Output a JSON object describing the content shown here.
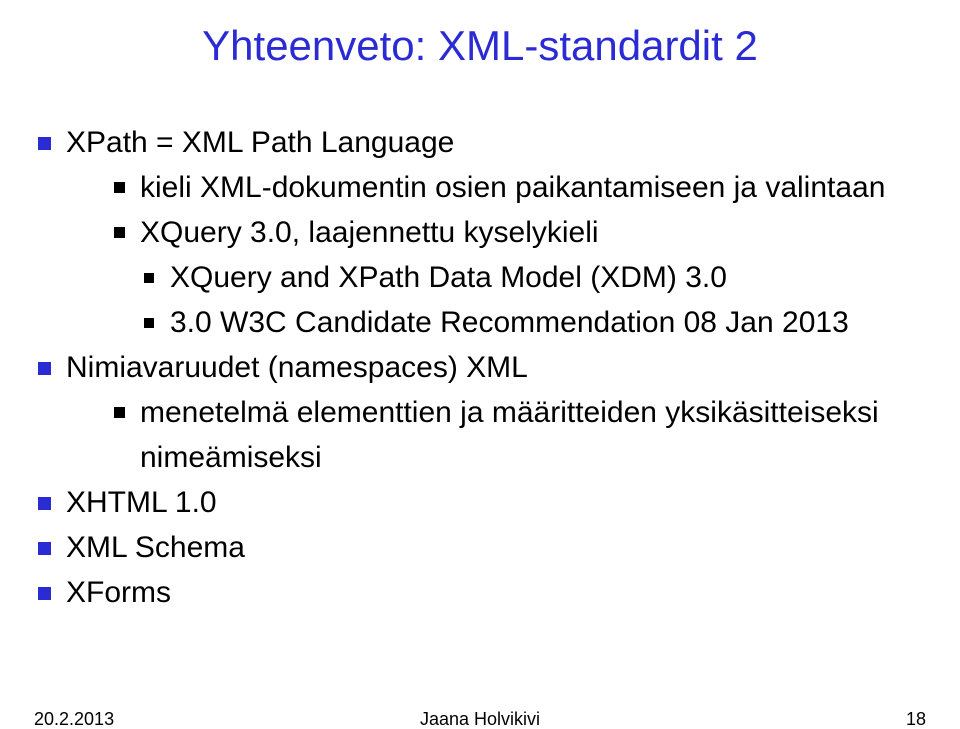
{
  "title": "Yhteenveto: XML-standardit 2",
  "bullets": {
    "b1": "XPath = XML Path Language",
    "b1_1": "kieli XML-dokumentin osien paikantamiseen ja valintaan",
    "b1_2": "XQuery 3.0, laajennettu kyselykieli",
    "b1_2_1": "XQuery and XPath Data Model (XDM) 3.0",
    "b1_2_2": "3.0 W3C Candidate Recommendation 08 Jan 2013",
    "b2": "Nimiavaruudet (namespaces) XML",
    "b2_1": "menetelmä elementtien ja määritteiden yksikäsitteiseksi nimeämiseksi",
    "b3": "XHTML 1.0",
    "b4": "XML Schema",
    "b5": "XForms"
  },
  "footer": {
    "date": "20.2.2013",
    "author": "Jaana Holvikivi",
    "page": "18"
  }
}
